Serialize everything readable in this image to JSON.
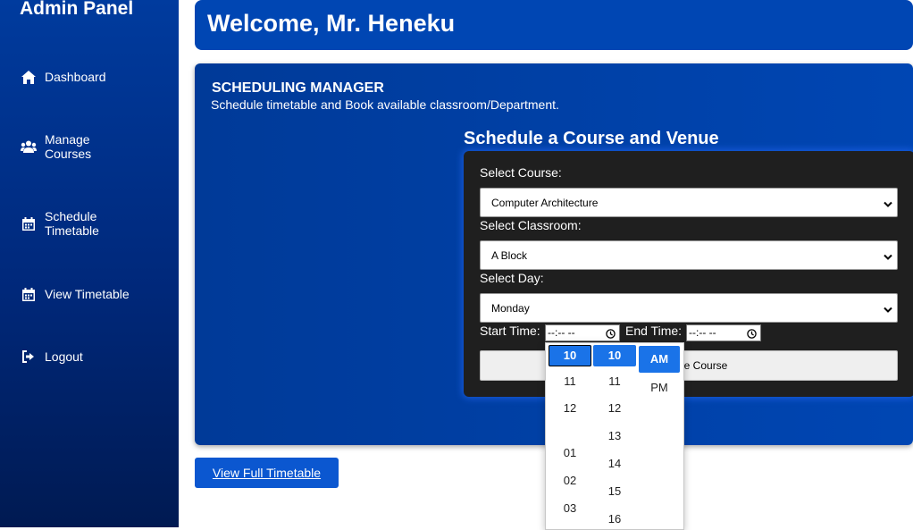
{
  "sidebar": {
    "brand": "Admin Panel",
    "items": [
      {
        "label": "Dashboard",
        "icon": "home-icon"
      },
      {
        "label": "Manage\nCourses",
        "icon": "users-icon"
      },
      {
        "label": "Schedule\nTimetable",
        "icon": "calendar-icon"
      },
      {
        "label": "View Timetable",
        "icon": "calendar-icon"
      },
      {
        "label": "Logout",
        "icon": "logout-icon"
      }
    ]
  },
  "header": {
    "title": "Welcome, Mr. Heneku"
  },
  "panel": {
    "title": "SCHEDULING MANAGER",
    "subtitle": "Schedule timetable and Book available classroom/Department.",
    "form_title": "Schedule a Course and Venue"
  },
  "form": {
    "course_label": "Select Course:",
    "course_value": "Computer Architecture",
    "classroom_label": "Select Classroom:",
    "classroom_value": "A Block",
    "day_label": "Select Day:",
    "day_value": "Monday",
    "start_label": "Start Time:",
    "start_value": "--:-- --",
    "end_label": "End Time:",
    "end_value": "--:-- --",
    "submit_label": "le Course"
  },
  "view_button": "View Full Timetable",
  "time_picker": {
    "hours": [
      "10",
      "11",
      "12",
      "01",
      "02",
      "03"
    ],
    "minutes": [
      "10",
      "11",
      "12",
      "13",
      "14",
      "15",
      "16"
    ],
    "periods": [
      "AM",
      "PM"
    ],
    "selected_hour": "10",
    "selected_minute": "10",
    "selected_period": "AM"
  },
  "colors": {
    "sidebar": "#00287a",
    "header": "#0046b3",
    "accent": "#1a73e8",
    "button": "#0b57d0",
    "form_bg": "#1f1f1f"
  }
}
